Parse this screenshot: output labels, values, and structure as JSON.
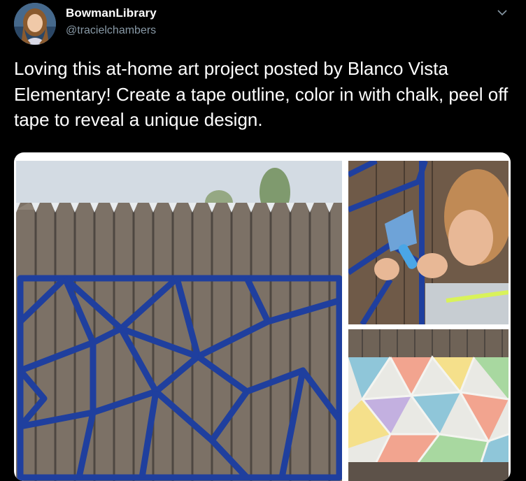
{
  "user": {
    "display_name": "BowmanLibrary",
    "handle": "@tracielchambers"
  },
  "icons": {
    "menu_caret": "chevron-down-icon"
  },
  "tweet": {
    "text": "Loving this at-home art project posted by Blanco Vista Elementary! Create a tape outline, color in with chalk, peel off tape to reveal a unique design."
  },
  "media": {
    "photos": [
      {
        "subject": "fence-with-tape-outline"
      },
      {
        "subject": "child-coloring-with-chalk"
      },
      {
        "subject": "finished-chalk-design"
      }
    ]
  },
  "colors": {
    "background": "#000000",
    "text": "#ffffff",
    "secondary_text": "#8899a6",
    "tape_blue": "#1f3f9e"
  }
}
